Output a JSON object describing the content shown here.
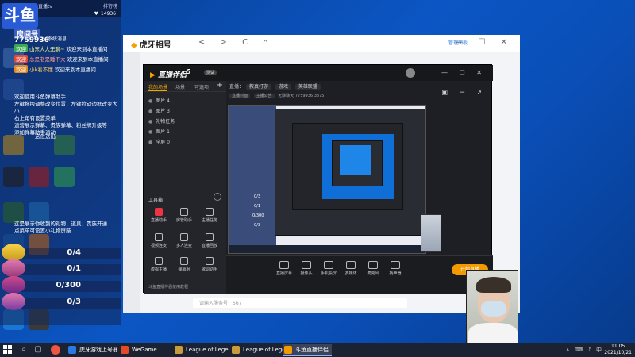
{
  "overlay": {
    "top_left": "斗鱼直播tv",
    "top_right": "排行榜",
    "heart": "♥",
    "heart_count": "14936",
    "logo": "斗鱼",
    "room_label": "房间号",
    "room_id": "7759936",
    "system_title": "系统消息",
    "chat": [
      {
        "tag": "欢迎",
        "user": "山东大大无聊~",
        "text": "欢迎来到本直播间"
      },
      {
        "tag": "欢迎",
        "user": "总是老是睡不大",
        "text": "欢迎来到本直播间"
      },
      {
        "tag": "欢迎",
        "user": "小k看不懂",
        "text": "欢迎来到本直播间"
      }
    ],
    "info_lines": [
      "欢迎使用斗鱼弹幕助手",
      "左键拖拽调整改变位置，左键拉动边框改变大小",
      "右上角有设置菜单",
      "运营展示弹幕、贵族弹幕、粉丝牌升级等",
      "添加弹幕助手运动"
    ],
    "gift_notice": "这位送出",
    "notice_lines": [
      "这是展示你收到的礼物、道具、贵族开通",
      "点菜单可设置小礼物屏蔽"
    ],
    "gifts": [
      {
        "count": "0/4"
      },
      {
        "count": "0/1"
      },
      {
        "count": "0/300"
      },
      {
        "count": "0/3"
      }
    ]
  },
  "huya": {
    "logo": "虎牙相号",
    "nav": "< > C ⌂",
    "btn": "管理面板",
    "ctrls": "— ☐ ✕",
    "search": "请输入服务号：567"
  },
  "assist": {
    "title": "直播伴侣",
    "title_suffix": "5",
    "badge": "测试",
    "tabs": [
      "我的场景",
      "场景",
      "可选项"
    ],
    "add": "+",
    "scenes": [
      "图片 4",
      "图片 3",
      "礼物任务",
      "图片 1",
      "全屏 0"
    ],
    "tools_title": "工具箱",
    "tools": [
      {
        "label": "直播助手",
        "hot": true
      },
      {
        "label": "房管助手",
        "hot": false
      },
      {
        "label": "主播任务",
        "hot": false
      },
      {
        "label": "视频连麦",
        "hot": false
      },
      {
        "label": "多人连麦",
        "hot": false
      },
      {
        "label": "直播回放",
        "hot": false
      },
      {
        "label": "虚拟主播",
        "hot": false
      },
      {
        "label": "弹幕姬",
        "hot": false
      },
      {
        "label": "歌词助手",
        "hot": false
      }
    ],
    "footer": "斗鱼直播伴侣使用教程",
    "info": {
      "title_label": "直播：",
      "title_value": "教真打游",
      "cat_box": "游戏",
      "sub_box": "英雄联盟",
      "room_tags": [
        "直播封面",
        "主播公告",
        "无聊聊天",
        "7759936",
        "3875"
      ]
    },
    "right_icons": "▣ ☰ ↗",
    "head_ctrls": "— ☐ ✕",
    "toolbar": [
      "直播屏幕",
      "摄像头",
      "手机投屏",
      "多媒体",
      "麦克风",
      "扬声器"
    ],
    "start": "开始直播",
    "preview_counts": [
      "0/3",
      "0/1",
      "0/300",
      "0/3"
    ]
  },
  "taskbar": {
    "tasks": [
      {
        "label": "虎牙游戏上号器",
        "color": "#2a7ae2"
      },
      {
        "label": "WeGame",
        "color": "#e24a2a"
      },
      {
        "label": "League of Legends",
        "color": "#c89b3c"
      },
      {
        "label": "League of Legen...",
        "color": "#c89b3c"
      },
      {
        "label": "斗鱼直播伴侣",
        "color": "#f39a00"
      }
    ],
    "tray": "∧ ⌨ ♪ 中",
    "time": "11:05",
    "date": "2021/10/21"
  },
  "colors": {
    "accent_orange": "#f39a00",
    "desktop_blue": "#0b56c4",
    "assist_bg": "#1d1f24"
  }
}
